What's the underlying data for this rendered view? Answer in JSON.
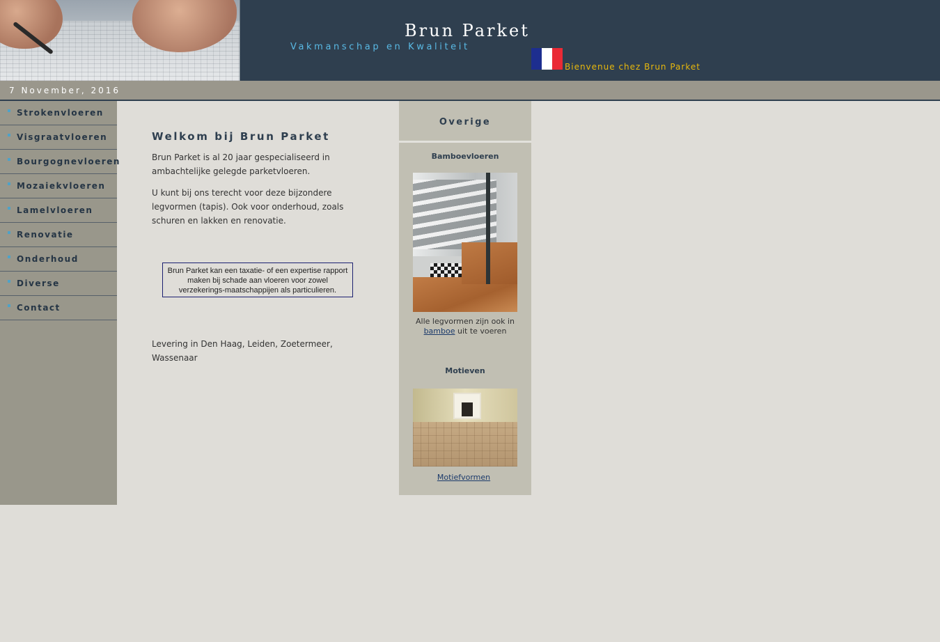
{
  "header": {
    "title": "Brun Parket",
    "tagline": "Vakmanschap en Kwaliteit",
    "language_welcome": "Bienvenue chez Brun Parket",
    "flag_icon": "france-flag-icon"
  },
  "datebar": {
    "date": "7 November, 2016"
  },
  "sidebar": {
    "items": [
      {
        "label": "Strokenvloeren"
      },
      {
        "label": "Visgraatvloeren"
      },
      {
        "label": "Bourgognevloeren"
      },
      {
        "label": "Mozaiekvloeren"
      },
      {
        "label": "Lamelvloeren"
      },
      {
        "label": "Renovatie"
      },
      {
        "label": "Onderhoud"
      },
      {
        "label": "Diverse"
      },
      {
        "label": "Contact"
      }
    ]
  },
  "main": {
    "heading": "Welkom bij Brun Parket",
    "p1": "Brun Parket is al 20 jaar gespecialiseerd in ambachtelijke gelegde parketvloeren.",
    "p2": "U kunt bij ons terecht voor deze bijzondere legvormen (tapis). Ook voor onderhoud, zoals schuren en lakken en renovatie.",
    "notice": "Brun Parket kan een taxatie- of een expertise rapport maken bij schade aan vloeren voor zowel verzekerings-maatschappijen als particulieren.",
    "p4": "Levering in Den Haag, Leiden, Zoetermeer, Wassenaar"
  },
  "rightcol": {
    "heading": "Overige",
    "bamboo_title": "Bamboevloeren",
    "bamboo_caption_before": "Alle legvormen zijn ook in",
    "bamboo_link": "bamboe",
    "bamboo_caption_after": "uit te voeren",
    "motief_title": "Motieven",
    "motief_link": "Motiefvormen"
  },
  "colors": {
    "header_bg": "#2f3f4f",
    "datebar_bg": "#9a978c",
    "sidebar_bg": "#99978b",
    "page_bg": "#dfddd8",
    "rightcol_bg": "#c1bfb3",
    "tagline": "#59b9e4",
    "welcome_fr": "#e8b80c"
  }
}
